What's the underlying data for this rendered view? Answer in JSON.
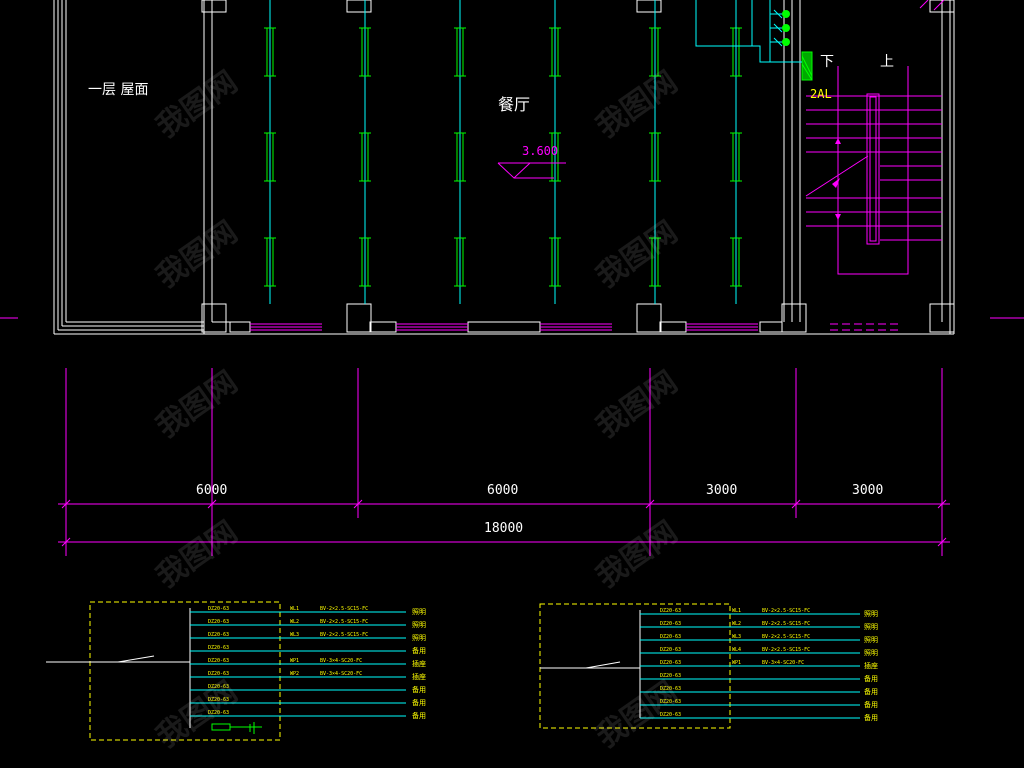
{
  "labels": {
    "roof": "一层 屋面",
    "dining": "餐厅",
    "elevation": "3.600",
    "down": "下",
    "up": "上",
    "panel": "2AL"
  },
  "dimensions": {
    "segments": [
      "6000",
      "6000",
      "3000",
      "3000"
    ],
    "total": "18000"
  },
  "schedule_left": {
    "breakers": [
      "DZ20-63",
      "DZ20-63",
      "DZ20-63",
      "DZ20-63",
      "DZ20-63",
      "DZ20-63",
      "DZ20-63",
      "DZ20-63",
      "DZ20-63"
    ],
    "circuit_ids": [
      "WL1",
      "WL2",
      "WL3",
      "",
      "WP1",
      "WP2",
      "",
      "",
      ""
    ],
    "cables": [
      "BV-2×2.5-SC15-FC",
      "BV-2×2.5-SC15-FC",
      "BV-2×2.5-SC15-FC",
      "",
      "BV-3×4-SC20-FC",
      "BV-3×4-SC20-FC",
      "",
      "",
      ""
    ],
    "uses": [
      "照明",
      "照明",
      "照明",
      "备用",
      "插座",
      "插座",
      "备用",
      "备用",
      "备用"
    ]
  },
  "schedule_right": {
    "breakers": [
      "DZ20-63",
      "DZ20-63",
      "DZ20-63",
      "DZ20-63",
      "DZ20-63",
      "DZ20-63",
      "DZ20-63",
      "DZ20-63",
      "DZ20-63"
    ],
    "circuit_ids": [
      "WL1",
      "WL2",
      "WL3",
      "WL4",
      "WP1",
      "",
      "",
      "",
      ""
    ],
    "cables": [
      "BV-2×2.5-SC15-FC",
      "BV-2×2.5-SC15-FC",
      "BV-2×2.5-SC15-FC",
      "BV-2×2.5-SC15-FC",
      "BV-3×4-SC20-FC",
      "",
      "",
      "",
      ""
    ],
    "uses": [
      "照明",
      "照明",
      "照明",
      "照明",
      "插座",
      "备用",
      "备用",
      "备用",
      "备用"
    ]
  },
  "watermark": "我图网",
  "colors": {
    "background": "#000000",
    "wall": "#ffffff",
    "axis": "#ff00ff",
    "light": "#00ff00",
    "wire": "#00ffff",
    "text": "#ffffff",
    "panel": "#ffff00"
  }
}
